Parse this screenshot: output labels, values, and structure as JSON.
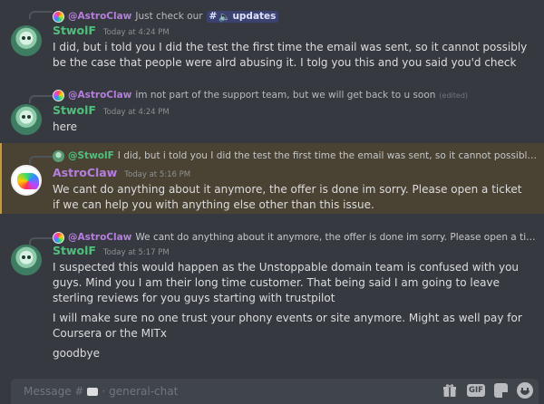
{
  "messages": [
    {
      "reply": {
        "author": "@AstroClaw",
        "text": "Just check our",
        "mention": "updates"
      },
      "author": "StwolF",
      "timestamp": "Today at 4:24 PM",
      "paragraphs": [
        "I did, but i told you I did the test the first time the email was sent, so it cannot possibly be the case that people were alrd abusing it. I tolg you this and you said you'd check"
      ]
    },
    {
      "reply": {
        "author": "@AstroClaw",
        "text": "im not part of the support team, but we will get back to u soon",
        "edited": "(edited)"
      },
      "author": "StwolF",
      "timestamp": "Today at 4:24 PM",
      "paragraphs": [
        "here"
      ]
    },
    {
      "reply": {
        "author": "@StwolF",
        "text": "I did, but i told you I did the test the first time the email was sent, so it cannot possibly be the c..."
      },
      "author": "AstroClaw",
      "timestamp": "Today at 5:16 PM",
      "paragraphs": [
        "We cant do anything about it anymore, the offer is done im sorry. Please open a ticket if we can help you with anything else other than this issue."
      ]
    },
    {
      "reply": {
        "author": "@AstroClaw",
        "text": "We cant do anything about it anymore, the offer is done im sorry. Please open a ticket if we..."
      },
      "author": "StwolF",
      "timestamp": "Today at 5:17 PM",
      "paragraphs": [
        "I suspected this would happen as the Unstoppable domain team is confused with you guys. Mind you I am their long time customer. That being said I am going to leave sterling reviews for you guys starting with trustpilot",
        "I will make sure no one trust your phony events or site anymore. Might as well pay for Coursera or the MITx",
        "goodbye"
      ]
    }
  ],
  "composer": {
    "placeholder_prefix": "Message #",
    "channel": "· general-chat",
    "gif_label": "GIF"
  },
  "colors": {
    "background": "#36393f",
    "highlight": "#4a4233",
    "highlight_bar": "#c59c3a",
    "green_name": "#4fc07c",
    "purple_name": "#b47fdc"
  },
  "icons": [
    "hash-icon",
    "speaker-icon",
    "gift-icon",
    "gif-icon",
    "sticker-icon",
    "emoji-icon",
    "channel-icon"
  ]
}
